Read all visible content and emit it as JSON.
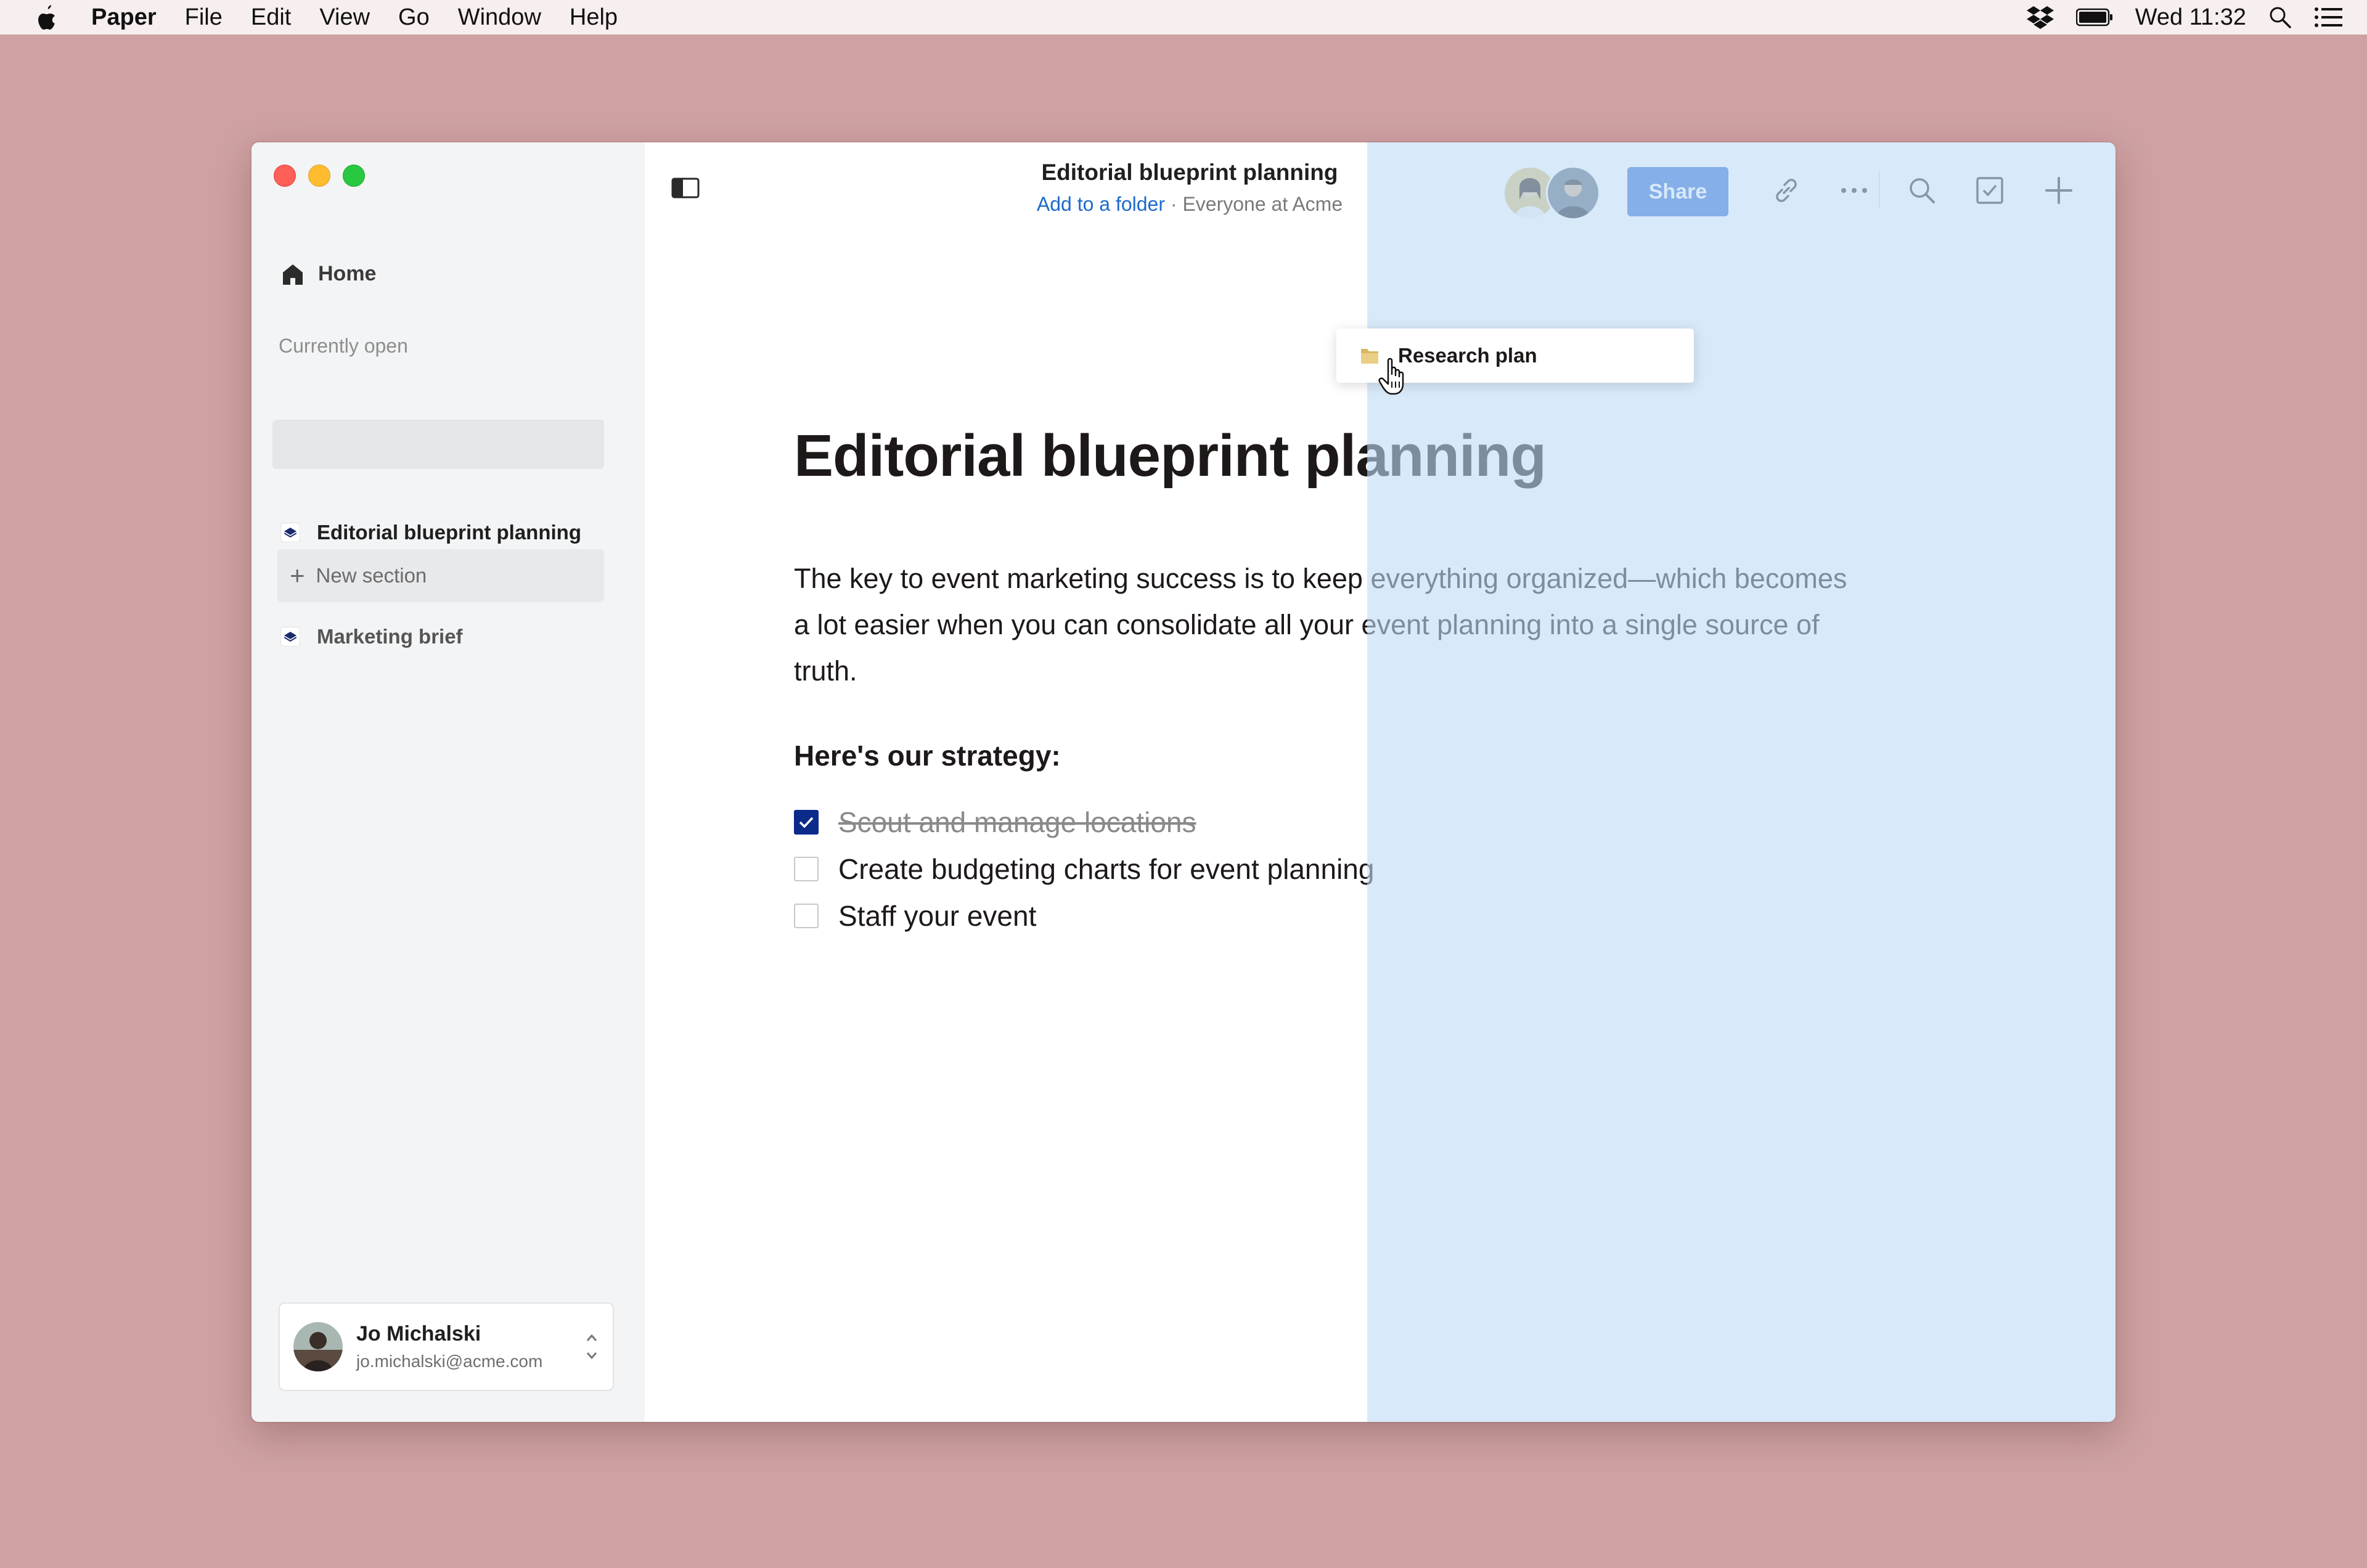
{
  "menubar": {
    "app_name": "Paper",
    "menus": [
      "File",
      "Edit",
      "View",
      "Go",
      "Window",
      "Help"
    ],
    "clock": "Wed 11:32"
  },
  "window": {
    "title": "Editorial blueprint planning",
    "subtitle_link": "Add to a folder",
    "subtitle_separator": " · ",
    "subtitle_scope": "Everyone at Acme",
    "share_label": "Share"
  },
  "sidebar": {
    "home_label": "Home",
    "section_label": "Currently open",
    "open_docs": [
      {
        "label": "Editorial blueprint planning"
      },
      {
        "label": "Marketing brief"
      }
    ],
    "new_section_label": "New section",
    "user": {
      "name": "Jo Michalski",
      "email": "jo.michalski@acme.com"
    }
  },
  "document": {
    "title": "Editorial blueprint planning",
    "body": "The key to event marketing success is to keep everything organized—which becomes a lot easier when you can consolidate all your event planning into a single source of truth.",
    "strategy_heading": "Here's our strategy:",
    "tasks": [
      {
        "label": "Scout and manage locations",
        "done": true
      },
      {
        "label": "Create budgeting charts for event planning",
        "done": false
      },
      {
        "label": "Staff your event",
        "done": false
      }
    ]
  },
  "drag_card": {
    "label": "Research plan"
  },
  "colors": {
    "desktop": "#cfa1a3",
    "accent": "#2f6fd8",
    "link": "#1d6acb",
    "checkbox_checked": "#0b2a8a",
    "drop_overlay": "#bedaf5"
  }
}
